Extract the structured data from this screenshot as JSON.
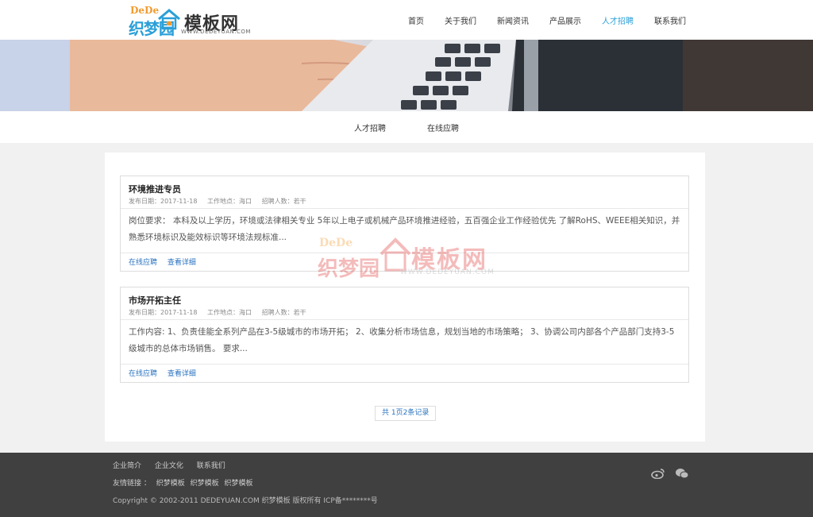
{
  "logo": {
    "dede": "DeDe",
    "zhimeng": "织梦园",
    "mb": "模板网",
    "url": "WWW.DEDEYUAN.COM"
  },
  "nav": [
    {
      "label": "首页",
      "active": false
    },
    {
      "label": "关于我们",
      "active": false
    },
    {
      "label": "新闻资讯",
      "active": false
    },
    {
      "label": "产品展示",
      "active": false
    },
    {
      "label": "人才招聘",
      "active": true
    },
    {
      "label": "联系我们",
      "active": false
    }
  ],
  "subnav": [
    "人才招聘",
    "在线应聘"
  ],
  "jobs": [
    {
      "title": "环境推进专员",
      "date": "发布日期：2017-11-18",
      "location": "工作地点：海口",
      "count": "招聘人数：若干",
      "desc": "岗位要求： 本科及以上学历，环境或法律相关专业 5年以上电子或机械产品环境推进经验，五百强企业工作经验优先 了解RoHS、WEEE相关知识，并熟悉环境标识及能效标识等环境法规标准...",
      "apply": "在线应聘",
      "detail": "查看详细"
    },
    {
      "title": "市场开拓主任",
      "date": "发布日期：2017-11-18",
      "location": "工作地点：海口",
      "count": "招聘人数：若干",
      "desc": "工作内容: 1、负责佳能全系列产品在3-5级城市的市场开拓；  2、收集分析市场信息，规划当地的市场策略；  3、协调公司内部各个产品部门支持3-5级城市的总体市场销售。 要求...",
      "apply": "在线应聘",
      "detail": "查看详细"
    }
  ],
  "pager": "共 1页2条记录",
  "watermark": {
    "dede": "DeDe",
    "zhimeng": "织梦园",
    "mb": "模板网",
    "url": "WWW.DEDEYUAN.COM"
  },
  "footer": {
    "links": [
      "企业简介",
      "企业文化",
      "联系我们"
    ],
    "friends_label": "友情链接 ：",
    "friends": [
      "织梦模板",
      "织梦模板",
      "织梦模板"
    ],
    "copyright": "Copyright © 2002-2011 DEDEYUAN.COM 织梦模板 版权所有 ICP备********号",
    "social_icons": [
      "weibo-icon",
      "wechat-icon"
    ]
  },
  "colors": {
    "accent": "#2a9fd8",
    "link": "#2a73c0",
    "footer_bg": "#404040"
  }
}
